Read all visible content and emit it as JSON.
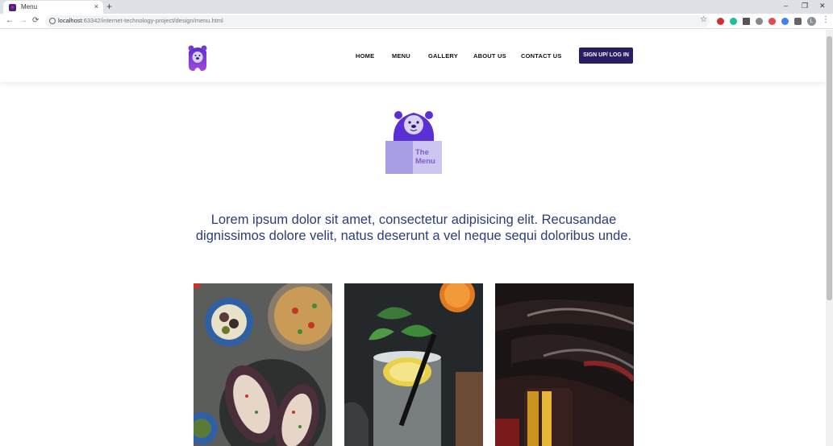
{
  "browser": {
    "tab_title": "Menu",
    "tab_close": "×",
    "new_tab": "+",
    "url_host": "localhost",
    "url_rest": ":63342/internet-technology-project/design/menu.html",
    "profile_initial": "L",
    "window_controls": {
      "minimize": "–",
      "restore": "❐",
      "close": "✕"
    },
    "nav": {
      "back": "←",
      "forward": "→",
      "reload": "⟳"
    }
  },
  "site": {
    "nav": {
      "home": "HOME",
      "menu": "MENU",
      "gallery": "GALLERY",
      "about": "ABOUT US",
      "contact": "CONTACT US"
    },
    "signup_label": "SIGN UP/ LOG IN",
    "hero": {
      "line1": "The",
      "line2": "Menu"
    },
    "lead_text": "Lorem ipsum dolor sit amet, consectetur adipisicing elit. Recusandae dignissimos dolore velit, natus deserunt a vel neque sequi doloribus unde."
  },
  "colors": {
    "brand_dark": "#2b1c63",
    "brand_purple": "#6a3fd8",
    "lead_text": "#2c3e7a"
  }
}
